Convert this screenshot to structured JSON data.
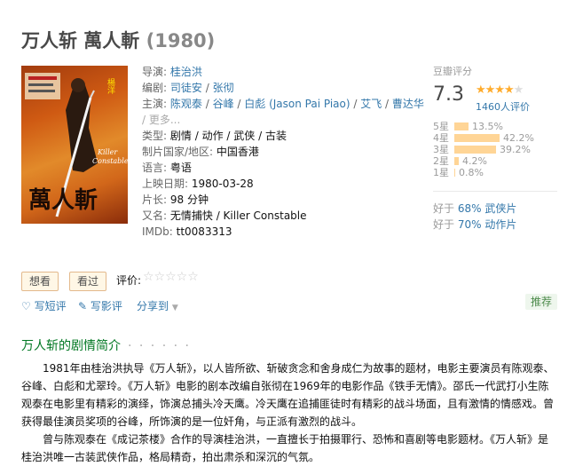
{
  "movie": {
    "title": "万人斩 萬人斬",
    "year": "(1980)"
  },
  "poster": {
    "top_name": "楊洋",
    "english_title_line1": "Killer",
    "english_title_line2": "Constable",
    "calligraphy": "萬人斬"
  },
  "info": {
    "director_label": "导演:",
    "director": "桂治洪",
    "writer_label": "编剧:",
    "writers": [
      "司徒安",
      "张彻"
    ],
    "cast_label": "主演:",
    "cast": [
      "陈观泰",
      "谷峰",
      "白彪 (Jason Pai Piao)",
      "艾飞",
      "曹达华"
    ],
    "more": "更多...",
    "genre_label": "类型:",
    "genres": [
      "剧情",
      "动作",
      "武侠",
      "古装"
    ],
    "country_label": "制片国家/地区:",
    "country": "中国香港",
    "language_label": "语言:",
    "language": "粤语",
    "release_label": "上映日期:",
    "release": "1980-03-28",
    "runtime_label": "片长:",
    "runtime": "98 分钟",
    "aka_label": "又名:",
    "aka": "无情捕快 / Killer Constable",
    "imdb_label": "IMDb:",
    "imdb": "tt0083313"
  },
  "rating": {
    "header": "豆瓣评分",
    "score": "7.3",
    "stars_filled": 3.5,
    "votes": "1460人评价",
    "distribution": [
      {
        "label": "5星",
        "percent": 13.5,
        "text": "13.5%"
      },
      {
        "label": "4星",
        "percent": 42.2,
        "text": "42.2%"
      },
      {
        "label": "3星",
        "percent": 39.2,
        "text": "39.2%"
      },
      {
        "label": "2星",
        "percent": 4.2,
        "text": "4.2%"
      },
      {
        "label": "1星",
        "percent": 0.8,
        "text": "0.8%"
      }
    ],
    "better1_prefix": "好于",
    "better1_link": "68% 武侠片",
    "better2_prefix": "好于",
    "better2_link": "70% 动作片"
  },
  "actions": {
    "want": "想看",
    "seen": "看过",
    "rate_label": "评价:",
    "rate_stars": "☆☆☆☆☆",
    "short_review": "写短评",
    "long_review": "写影评",
    "share": "分享到",
    "recommend": "推荐"
  },
  "summary": {
    "title": "万人斩的剧情简介",
    "dots": "· · · · · ·",
    "p1": "1981年由桂治洪执导《万人斩》，以人皆所欲、斩破贪念和舍身成仁为故事的题材，电影主要演员有陈观泰、谷峰、白彪和尤翠玲。《万人斩》电影的剧本改编自张彻在1969年的电影作品《铁手无情》。邵氏一代武打小生陈观泰在电影里有精彩的演绎，饰演总捕头冷天鹰。冷天鹰在追捕匪徒时有精彩的战斗场面，且有激情的情感戏。曾获得最佳演员奖项的谷峰，所饰演的是一位奸角，与正派有激烈的战斗。",
    "p2": "曾与陈观泰在《成记茶楼》合作的导演桂治洪，一直擅长于拍摄罪行、恐怖和喜剧等电影题材。《万人斩》是桂治洪唯一古装武侠作品，格局精奇，拍出肃杀和深沉的气氛。"
  }
}
